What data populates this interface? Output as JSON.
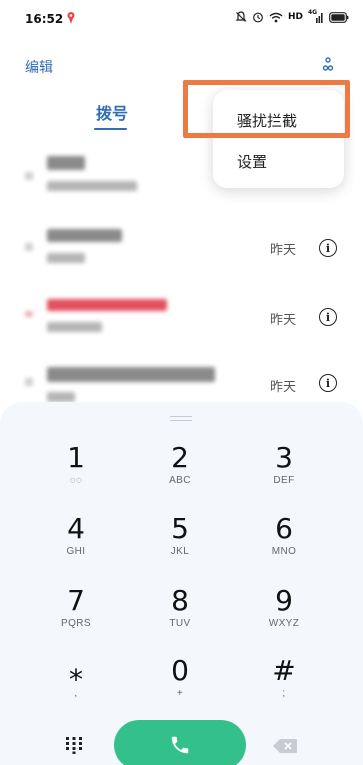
{
  "status_bar": {
    "time": "16:52",
    "network_label": "HD",
    "signal_label": "4G",
    "icons": [
      "location-pin-icon",
      "alarm-off-icon",
      "alarm-clock-icon",
      "wifi-icon",
      "signal-icon",
      "battery-icon"
    ]
  },
  "header": {
    "edit_label": "编辑",
    "more_icon": "more-vertical-icon"
  },
  "tabs": {
    "dial_label": "拨号"
  },
  "menu": {
    "items": [
      {
        "label": "骚扰拦截"
      },
      {
        "label": "设置"
      }
    ],
    "highlight_color": "#ec7a45"
  },
  "call_log": {
    "rows": [
      {
        "date": "",
        "name_color": "#7a7a7a"
      },
      {
        "date": "昨天",
        "name_color": "#7a7a7a"
      },
      {
        "date": "昨天",
        "name_color": "#e35060"
      },
      {
        "date": "昨天",
        "name_color": "#7a7a7a"
      }
    ],
    "info_glyph": "i"
  },
  "keypad": {
    "keys": [
      {
        "digit": "1",
        "letters": "◌◌"
      },
      {
        "digit": "2",
        "letters": "ABC"
      },
      {
        "digit": "3",
        "letters": "DEF"
      },
      {
        "digit": "4",
        "letters": "GHI"
      },
      {
        "digit": "5",
        "letters": "JKL"
      },
      {
        "digit": "6",
        "letters": "MNO"
      },
      {
        "digit": "7",
        "letters": "PQRS"
      },
      {
        "digit": "8",
        "letters": "TUV"
      },
      {
        "digit": "9",
        "letters": "WXYZ"
      },
      {
        "digit": "⁎",
        "letters": ","
      },
      {
        "digit": "0",
        "letters": "+"
      },
      {
        "digit": "#",
        "letters": ";"
      }
    ],
    "call_color": "#34c08a"
  }
}
